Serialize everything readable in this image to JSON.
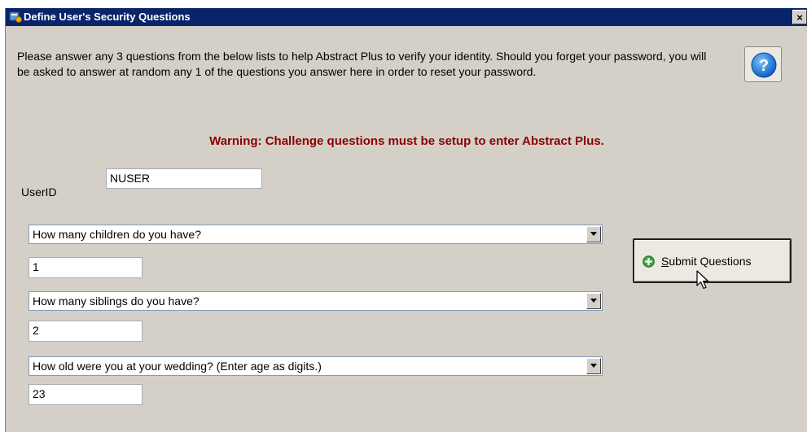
{
  "window": {
    "title": "Define User's Security Questions",
    "close_glyph": "×",
    "icon": "app-icon"
  },
  "intro_text": "Please answer any 3 questions from the below lists to help Abstract Plus to verify your identity. Should you forget your password, you will be asked to answer at random any 1 of the questions you answer here in order to reset your password.",
  "help_button": {
    "icon": "help-question-icon",
    "glyph": "?"
  },
  "warning_text": "Warning: Challenge questions must be setup to enter Abstract Plus.",
  "userid": {
    "label": "UserID",
    "value": "NUSER"
  },
  "questions": [
    {
      "question": "How many children do you have?",
      "answer": "1"
    },
    {
      "question": "How many siblings do you have?",
      "answer": "2"
    },
    {
      "question": "How old were you at your wedding? (Enter age as digits.)",
      "answer": "23"
    }
  ],
  "submit_button": {
    "mnemonic": "S",
    "label_rest": "ubmit Questions",
    "icon": "green-plus-icon"
  },
  "colors": {
    "titlebar": "#0a246a",
    "warning": "#8b0000",
    "dialog_bg": "#d4d0c8"
  }
}
